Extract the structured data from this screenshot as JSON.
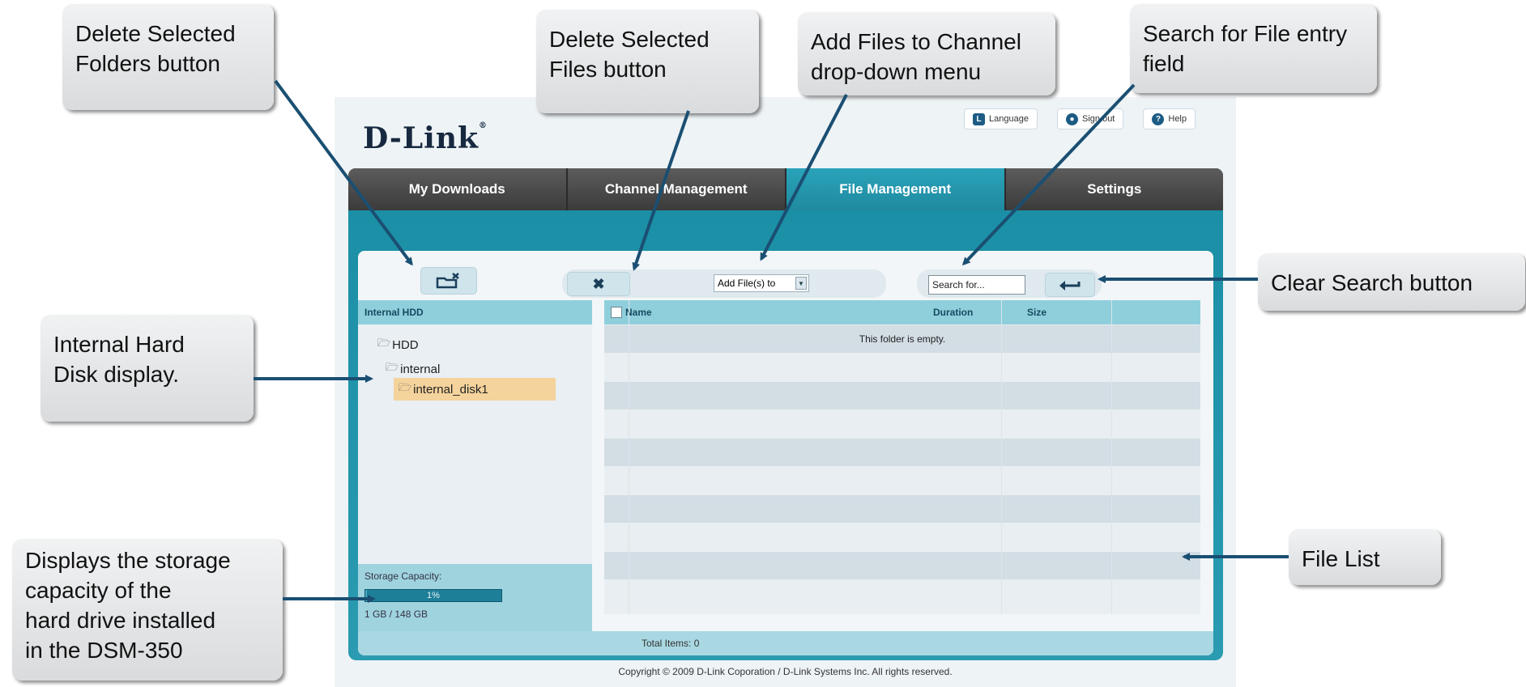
{
  "app": {
    "logo": "D-Link",
    "top_links": [
      {
        "label": "Language",
        "icon": "language-icon"
      },
      {
        "label": "Sign out",
        "icon": "user-icon"
      },
      {
        "label": "Help",
        "icon": "help-icon"
      }
    ],
    "tabs": [
      {
        "label": "My Downloads",
        "active": false
      },
      {
        "label": "Channel Management",
        "active": false
      },
      {
        "label": "File Management",
        "active": true
      },
      {
        "label": "Settings",
        "active": false
      }
    ],
    "toolbar": {
      "delete_folders_icon": "delete-folder-icon",
      "delete_files_icon": "delete-x-icon",
      "add_files_select": "Add File(s) to",
      "search_placeholder": "Search for...",
      "clear_search_icon": "return-arrow-icon"
    },
    "tree": {
      "header": "Internal HDD",
      "nodes": [
        {
          "label": "HDD",
          "selected": false
        },
        {
          "label": "internal",
          "selected": false
        },
        {
          "label": "internal_disk1",
          "selected": true
        }
      ]
    },
    "storage": {
      "label": "Storage Capacity:",
      "percent_text": "1%",
      "percent": 1,
      "used": "1 GB / 148 GB"
    },
    "file_list": {
      "columns": [
        "Name",
        "Duration",
        "Size"
      ],
      "empty_message": "This folder is empty.",
      "total": "Total Items: 0"
    },
    "copyright": "Copyright © 2009 D-Link Coporation / D-Link Systems Inc. All rights reserved.",
    "accent_color": "#1f8aa0"
  },
  "callouts": {
    "delete_folders": [
      "Delete Selected",
      "Folders button"
    ],
    "delete_files": [
      "Delete Selected",
      "Files button"
    ],
    "add_files": [
      "Add Files to Channel",
      "drop-down menu"
    ],
    "search": [
      "Search for File entry",
      "field"
    ],
    "clear_search": [
      "Clear Search button"
    ],
    "hdd_display": [
      "Internal Hard",
      "Disk display."
    ],
    "storage": [
      "Displays the storage",
      "capacity of the",
      "hard drive installed",
      "in the DSM-350"
    ],
    "file_list": [
      "File List"
    ]
  }
}
